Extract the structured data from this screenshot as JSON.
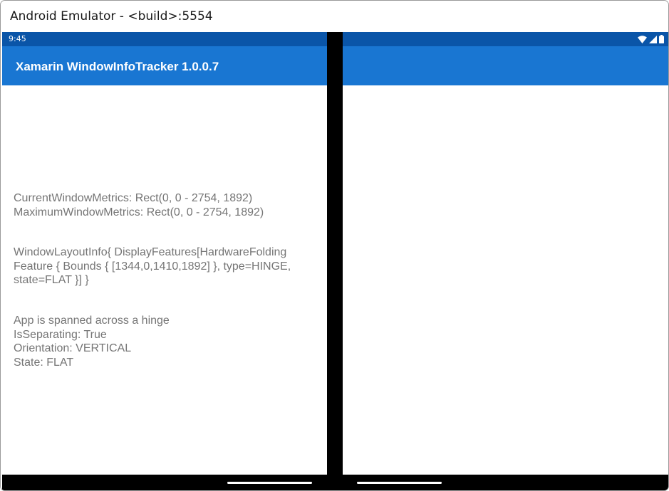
{
  "window": {
    "title": "Android Emulator - <build>:5554"
  },
  "statusbar": {
    "time": "9:45",
    "icons": [
      "wifi-icon",
      "cellular-signal-icon",
      "battery-icon"
    ]
  },
  "appbar": {
    "title": "Xamarin WindowInfoTracker 1.0.0.7"
  },
  "content": {
    "metrics": [
      "CurrentWindowMetrics: Rect(0, 0 - 2754, 1892)",
      "MaximumWindowMetrics: Rect(0, 0 - 2754, 1892)"
    ],
    "layout_info": [
      "WindowLayoutInfo{ DisplayFeatures[HardwareFolding",
      "Feature { Bounds { [1344,0,1410,1892] }, type=HINGE,",
      "state=FLAT }] }"
    ],
    "status": [
      "App is spanned across a hinge",
      "IsSeparating: True",
      "Orientation: VERTICAL",
      "State: FLAT"
    ]
  },
  "colors": {
    "statusbar": "#0a55a8",
    "appbar": "#1976d2",
    "text": "#757575",
    "hinge": "#000000"
  }
}
